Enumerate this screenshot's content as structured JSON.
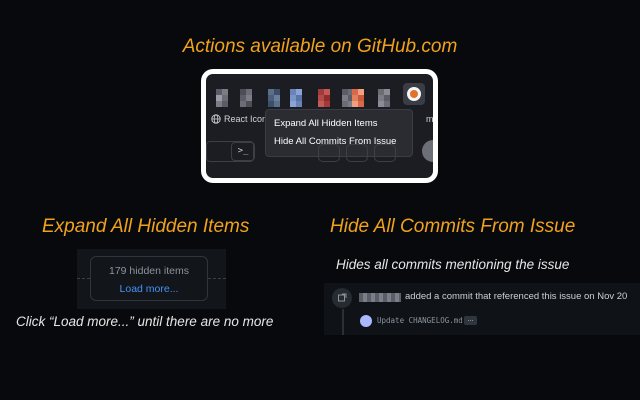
{
  "headings": {
    "main": "Actions available on GitHub.com",
    "expand": "Expand All Hidden Items",
    "hide": "Hide All Commits From Issue"
  },
  "browser": {
    "bookmark_label": "React Icon",
    "bookmark_edge": "m",
    "menu": {
      "items": [
        "Expand All Hidden Items",
        "Hide All Commits From Issue"
      ]
    },
    "terminal_label": ">_"
  },
  "expand_demo": {
    "hidden_count_text": "179 hidden items",
    "load_more_label": "Load more...",
    "caption": "Click “Load more...” until  there are no more"
  },
  "hide_demo": {
    "caption": "Hides all commits mentioning the issue",
    "event_text": "added a commit that referenced this issue on Nov 20",
    "commit_message": "Update CHANGELOG.md",
    "ellipsis_label": "..."
  },
  "colors": {
    "heading": "#f0a21c",
    "link": "#4493f8",
    "background": "#08090c"
  }
}
